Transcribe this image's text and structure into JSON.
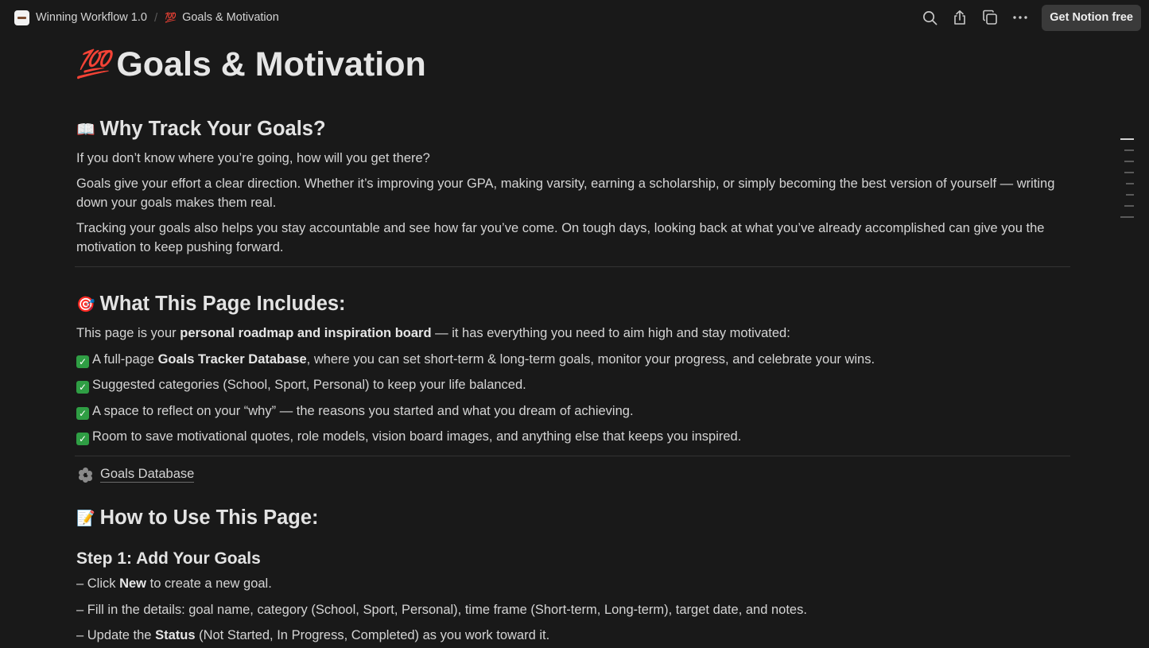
{
  "topbar": {
    "workspace": "Winning Workflow 1.0",
    "separator": "/",
    "page_emoji": "💯",
    "page": "Goals & Motivation",
    "cta": "Get Notion free"
  },
  "page": {
    "title_emoji": "💯",
    "title": "Goals & Motivation",
    "section1": {
      "emoji": "📖",
      "heading": "Why Track Your Goals?",
      "p1": "If you don’t know where you’re going, how will you get there?",
      "p2": "Goals give your effort a clear direction. Whether it’s improving your GPA, making varsity, earning a scholarship, or simply becoming the best version of yourself — writing down your goals makes them real.",
      "p3": "Tracking your goals also helps you stay accountable and see how far you’ve come. On tough days, looking back at what you’ve already accomplished can give you the motivation to keep pushing forward."
    },
    "section2": {
      "emoji": "🎯",
      "heading": "What This Page Includes:",
      "intro_pre": "This page is your ",
      "intro_bold": "personal roadmap and inspiration board",
      "intro_post": " — it has everything you need to aim high and stay motivated:",
      "item1_pre": "A full-page ",
      "item1_bold": "Goals Tracker Database",
      "item1_post": ", where you can set short-term & long-term goals, monitor your progress, and celebrate your wins.",
      "item2": "Suggested categories (School, Sport, Personal) to keep your life balanced.",
      "item3": "A space to reflect on your “why” — the reasons you started and what you dream of achieving.",
      "item4": "Room to save motivational quotes, role models, vision board images, and anything else that keeps you inspired."
    },
    "db_link": "Goals Database",
    "section3": {
      "emoji": "📝",
      "heading": "How to Use This Page:",
      "step1": "Step 1: Add Your Goals",
      "l1_pre": "– Click ",
      "l1_bold": "New",
      "l1_post": " to create a new goal.",
      "l2": "– Fill in the details: goal name, category (School, Sport, Personal), time frame (Short-term, Long-term), target date, and notes.",
      "l3_pre": "– Update the ",
      "l3_bold": "Status",
      "l3_post": " (Not Started, In Progress, Completed) as you work toward it."
    }
  }
}
